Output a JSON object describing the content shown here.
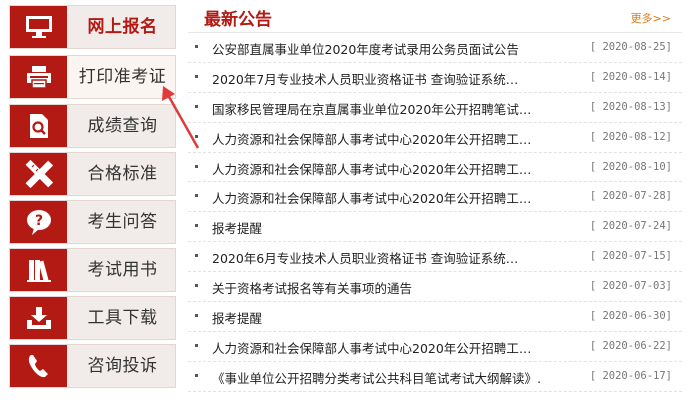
{
  "menu": {
    "items": [
      {
        "label": "网上报名",
        "icon": "computer-icon"
      },
      {
        "label": "打印准考证",
        "icon": "printer-icon"
      },
      {
        "label": "成绩查询",
        "icon": "document-search-icon"
      },
      {
        "label": "合格标准",
        "icon": "ruler-pencil-icon"
      },
      {
        "label": "考生问答",
        "icon": "question-bubble-icon"
      },
      {
        "label": "考试用书",
        "icon": "books-icon"
      },
      {
        "label": "工具下载",
        "icon": "download-tray-icon"
      },
      {
        "label": "咨询投诉",
        "icon": "telephone-icon"
      }
    ]
  },
  "notices": {
    "title": "最新公告",
    "more": "更多>>",
    "items": [
      {
        "text": "公安部直属事业单位2020年度考试录用公务员面试公告",
        "date": "[ 2020-08-25]"
      },
      {
        "text": "2020年7月专业技术人员职业资格证书 查询验证系统…",
        "date": "[ 2020-08-14]"
      },
      {
        "text": "国家移民管理局在京直属事业单位2020年公开招聘笔试…",
        "date": "[ 2020-08-13]"
      },
      {
        "text": "人力资源和社会保障部人事考试中心2020年公开招聘工…",
        "date": "[ 2020-08-12]"
      },
      {
        "text": "人力资源和社会保障部人事考试中心2020年公开招聘工…",
        "date": "[ 2020-08-10]"
      },
      {
        "text": "人力资源和社会保障部人事考试中心2020年公开招聘工…",
        "date": "[ 2020-07-28]"
      },
      {
        "text": "报考提醒",
        "date": "[ 2020-07-24]"
      },
      {
        "text": "2020年6月专业技术人员职业资格证书 查询验证系统…",
        "date": "[ 2020-07-15]"
      },
      {
        "text": "关于资格考试报名等有关事项的通告",
        "date": "[ 2020-07-03]"
      },
      {
        "text": "报考提醒",
        "date": "[ 2020-06-30]"
      },
      {
        "text": "人力资源和社会保障部人事考试中心2020年公开招聘工…",
        "date": "[ 2020-06-22]"
      },
      {
        "text": "《事业单位公开招聘分类考试公共科目笔试考试大纲解读》…",
        "date": "[ 2020-06-17]"
      }
    ]
  },
  "colors": {
    "accent": "#b41a14",
    "more": "#e07b15",
    "menu_bg": "#f1ecea"
  }
}
